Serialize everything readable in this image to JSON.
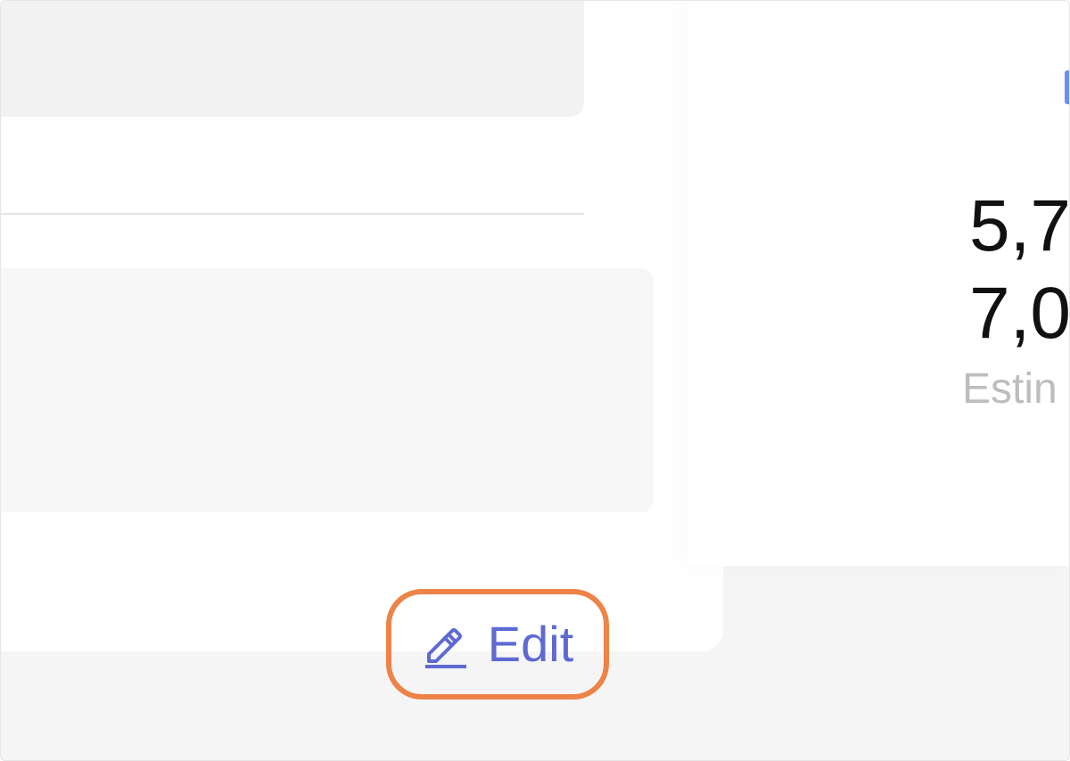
{
  "edit_control": {
    "label": "Edit",
    "icon": "pencil-icon",
    "highlight_color": "#ee8347",
    "text_color": "#5e6ad2"
  },
  "summary": {
    "value_1": "5,7",
    "value_2": "7,0",
    "caption": "Estin"
  },
  "colors": {
    "accent": "#6b8ff0",
    "panel_gray": "#f7f7f7",
    "background": "#f5f5f5"
  }
}
